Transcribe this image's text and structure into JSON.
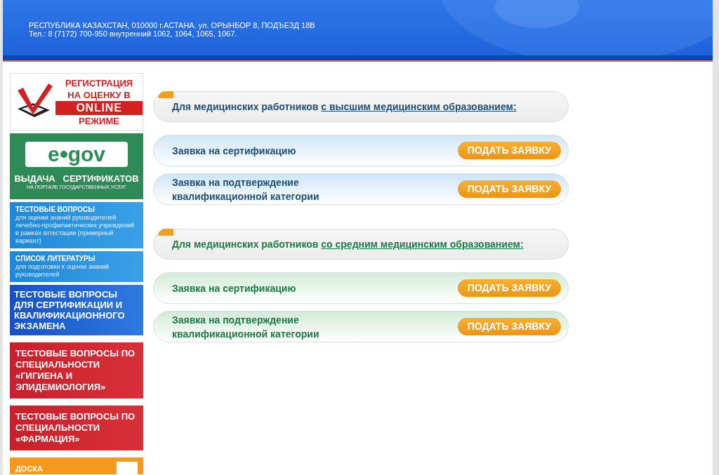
{
  "header": {
    "address": "РЕСПУБЛИКА КАЗАХСТАН, 010000 г.АСТАНА. ул. ОРЫНБОР 8, ПОДЪЕЗД 18В",
    "phone": "Тел.: 8 (7172) 700-950 внутренний 1062, 1064, 1065, 1067."
  },
  "sidebar": [
    {
      "kind": "registration",
      "lines": [
        "РЕГИСТРАЦИЯ",
        "НА ОЦЕНКУ В"
      ],
      "highlight": "ONLINE",
      "footer": "РЕЖИМЕ"
    },
    {
      "kind": "egov",
      "logo_left": "e",
      "logo_right": "gov",
      "title": "ВЫДАЧА   СЕРТИФИКАТОВ",
      "subtitle": "НА ПОРТАЛЕ ГОСУДАРСТВЕННЫХ УСЛУГ"
    },
    {
      "kind": "info",
      "title": "ТЕСТОВЫЕ ВОПРОСЫ",
      "subtitle": "для оценки знаний руководителей лечебно-профилактических учреждений в рамках аттестации (примерный вариант)"
    },
    {
      "kind": "info",
      "title": "СПИСОК ЛИТЕРАТУРЫ",
      "subtitle": "для подготовки к оценке знаний руководителей"
    },
    {
      "kind": "big",
      "title": "ТЕСТОВЫЕ ВОПРОСЫ ДЛЯ СЕРТИФИКАЦИИ И КВАЛИФИКАЦИОННОГО ЭКЗАМЕНА"
    },
    {
      "kind": "red",
      "title": "ТЕСТОВЫЕ ВОПРОСЫ ПО СПЕЦИАЛЬНОСТИ «ГИГИЕНА И ЭПИДЕМИОЛОГИЯ»"
    },
    {
      "kind": "red",
      "title": "ТЕСТОВЫЕ ВОПРОСЫ ПО СПЕЦИАЛЬНОСТИ «ФАРМАЦИЯ»"
    },
    {
      "kind": "board",
      "title": "ДОСКА"
    }
  ],
  "sections": [
    {
      "color": "#1f4e79",
      "heading": "Для медицинских работников",
      "link": "с высшим медицинским образованием:",
      "rows": [
        {
          "label": "Заявка на сертификацию",
          "button": "ПОДАТЬ ЗАЯВКУ"
        },
        {
          "label": "Заявка на подтверждение квалификационной категории",
          "button": "ПОДАТЬ ЗАЯВКУ"
        }
      ]
    },
    {
      "color": "#1e7a45",
      "heading": "Для медицинских работников",
      "link": "со средним медицинским образованием:",
      "rows": [
        {
          "label": "Заявка на сертификацию",
          "button": "ПОДАТЬ ЗАЯВКУ"
        },
        {
          "label": "Заявка на подтверждение квалификационной категории",
          "button": "ПОДАТЬ ЗАЯВКУ"
        }
      ]
    }
  ]
}
